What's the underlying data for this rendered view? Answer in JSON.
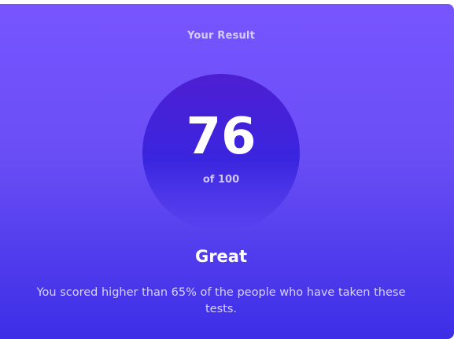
{
  "result": {
    "heading": "Your Result",
    "score": "76",
    "max_label": "of 100",
    "grade": "Great",
    "summary": "You scored higher than 65% of the people who have taken these tests."
  },
  "colors": {
    "card_top": "#7755ff",
    "card_bottom": "#3c2ee6",
    "circle_top": "#4e1fd2",
    "circle_bottom": "#3a25df",
    "text": "#ffffff"
  }
}
